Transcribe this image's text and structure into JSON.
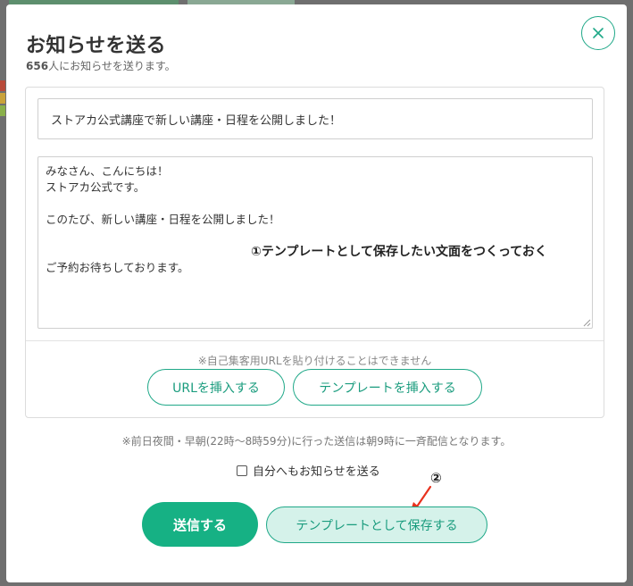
{
  "modal": {
    "title": "お知らせを送る",
    "recipient_count": "656",
    "recipient_suffix": "人にお知らせを送ります。",
    "close_icon": "close-icon"
  },
  "form": {
    "subject_value": "ストアカ公式講座で新しい講座・日程を公開しました！",
    "body_value": "みなさん、こんにちは！\nストアカ公式です。\n\nこのたび、新しい講座・日程を公開しました！\n\n\nご予約お待ちしております。",
    "url_note": "※自己集客用URLを貼り付けることはできません",
    "insert_url_label": "URLを挿入する",
    "insert_template_label": "テンプレートを挿入する"
  },
  "night_note": "※前日夜間・早朝(22時〜8時59分)に行った送信は朝9時に一斉配信となります。",
  "self_notify": {
    "label": "自分へもお知らせを送る",
    "checked": false
  },
  "actions": {
    "send_label": "送信する",
    "save_template_label": "テンプレートとして保存する"
  },
  "annotations": {
    "step1": "①テンプレートとして保存したい文面をつくっておく",
    "step2": "②",
    "arrow_color": "#e8321e"
  },
  "colors": {
    "accent": "#16b184",
    "accent_light": "#d5f2ea"
  }
}
